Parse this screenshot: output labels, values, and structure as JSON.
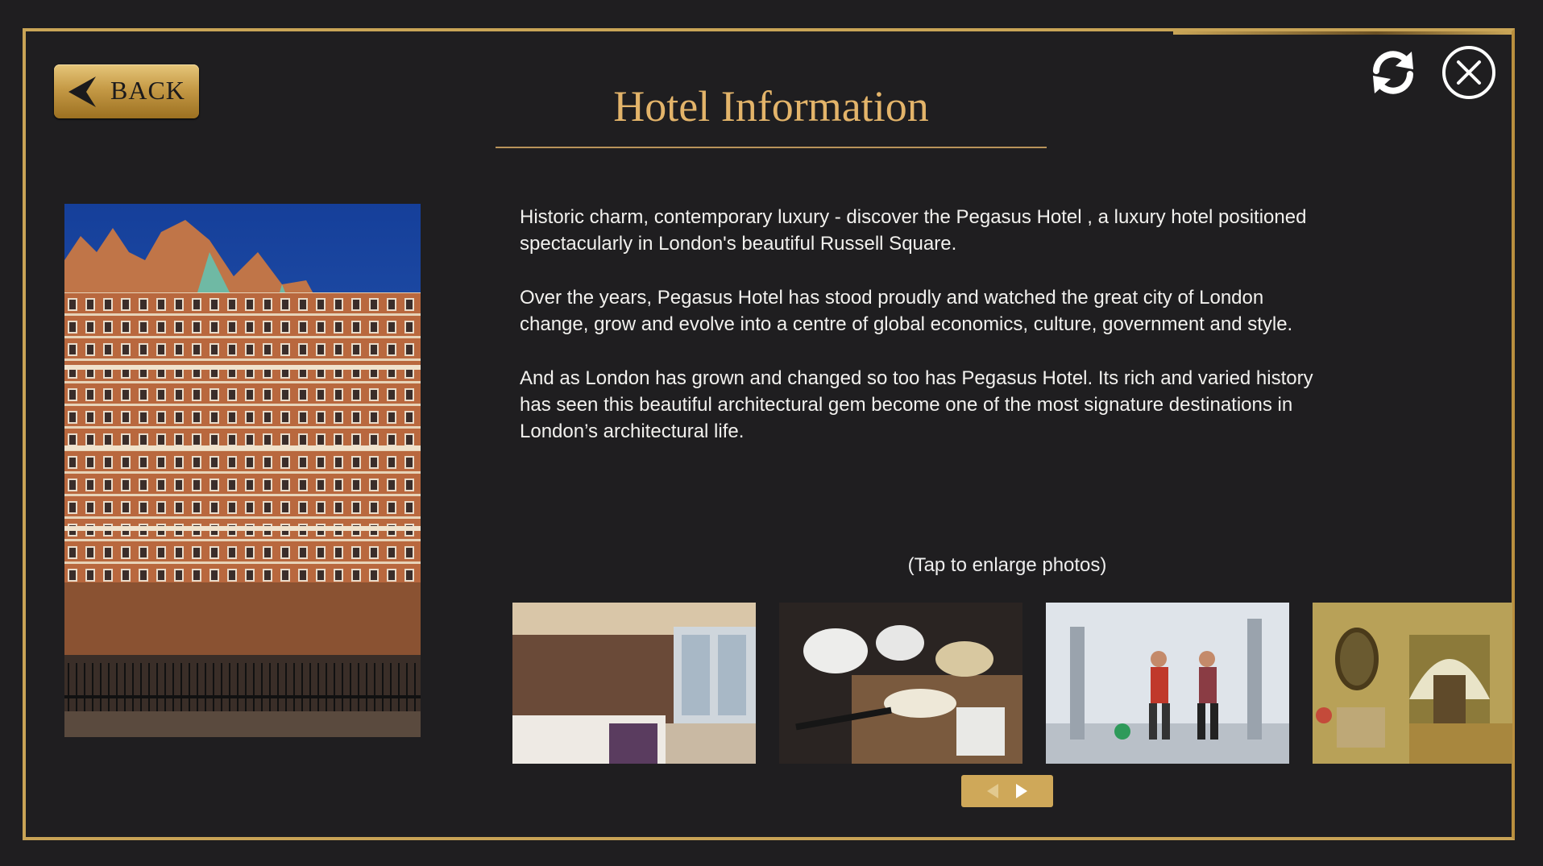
{
  "header": {
    "back_label": "BACK",
    "title": "Hotel Information"
  },
  "icons": {
    "back": "left-arrow-icon",
    "refresh": "refresh-icon",
    "close": "close-icon",
    "prev": "chevron-left-icon",
    "next": "chevron-right-icon"
  },
  "description": {
    "paragraphs": [
      "Historic charm, contemporary luxury -  discover the Pegasus Hotel , a luxury hotel positioned spectacularly in London's beautiful Russell Square.",
      "Over the years, Pegasus Hotel has stood proudly and watched the great city of London change, grow and evolve into a centre of global economics, culture, government and style.",
      "And as London has grown and changed so too has Pegasus Hotel. Its rich and varied history has seen this beautiful architectural gem become one of the most signature destinations in London’s architectural life."
    ]
  },
  "gallery": {
    "hint": "(Tap to enlarge photos)",
    "photos": [
      "hotel-room-photo",
      "kitchen-chef-photo",
      "gym-photo",
      "hallway-lounge-photo"
    ]
  },
  "colors": {
    "background": "#1f1e20",
    "gold": "#c8a356",
    "title": "#e3b46a",
    "text": "#f2f1ee"
  }
}
